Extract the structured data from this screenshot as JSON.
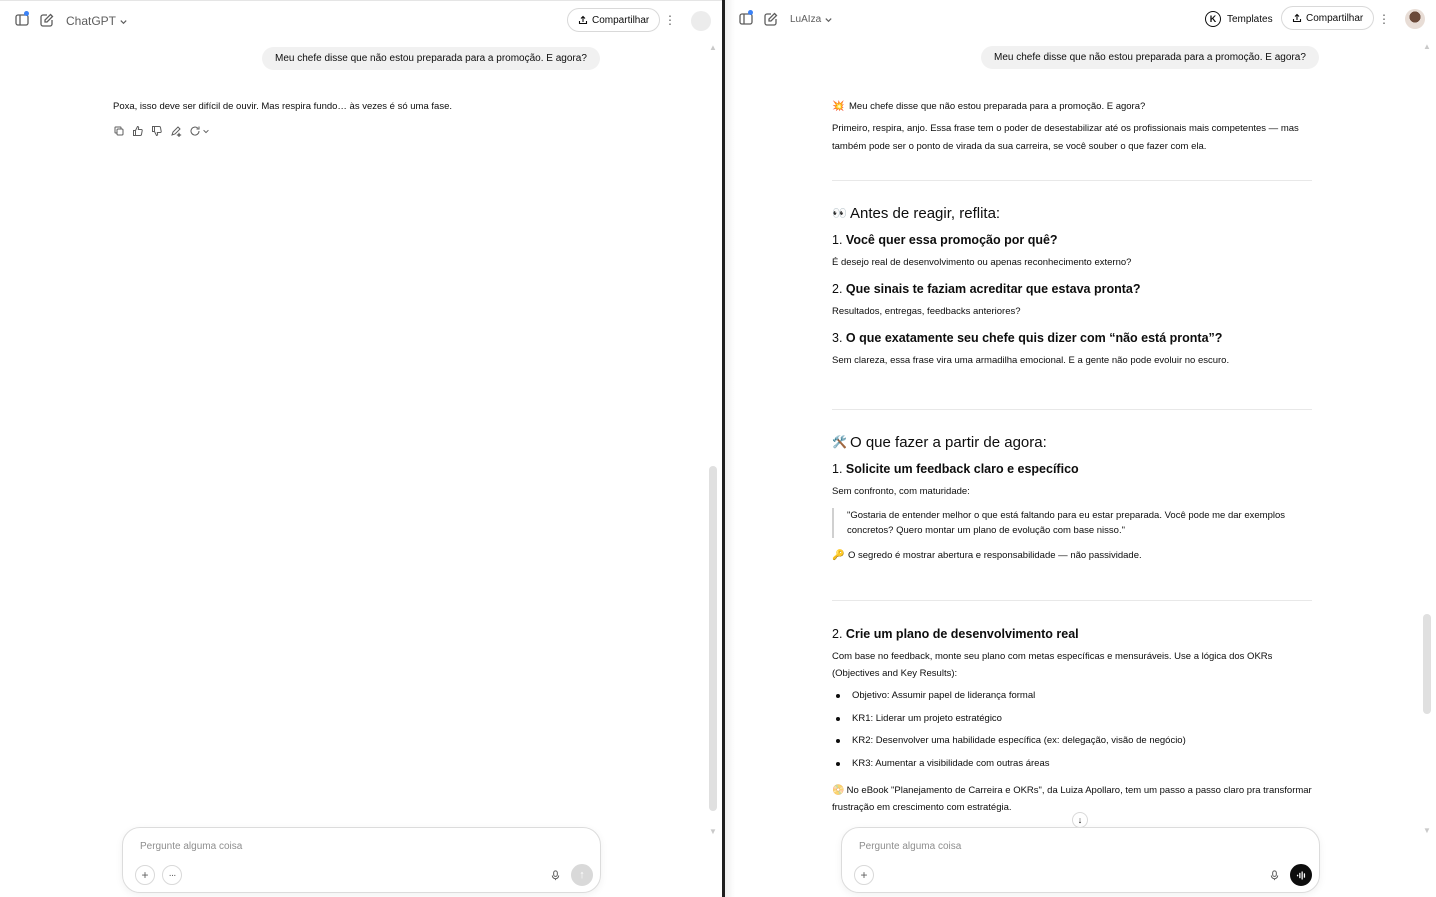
{
  "left": {
    "model_name": "ChatGPT",
    "share_label": "Compartilhar",
    "user_message": "Meu chefe disse que não estou preparada para a promoção. E agora?",
    "assistant_message": "Poxa, isso deve ser difícil de ouvir. Mas respira fundo… às vezes é só uma fase.",
    "composer_placeholder": "Pergunte alguma coisa"
  },
  "right": {
    "model_name": "LuAIza",
    "templates_label": "Templates",
    "share_label": "Compartilhar",
    "user_message": "Meu chefe disse que não estou preparada para a promoção. E agora?",
    "intro_title": "Meu chefe disse que não estou preparada para a promoção. E agora?",
    "intro_text": "Primeiro, respira, anjo. Essa frase tem o poder de desestabilizar até os profissionais mais competentes — mas também pode ser o ponto de virada da sua carreira, se você souber o que fazer com ela.",
    "section1": {
      "emoji": "👀",
      "title": "Antes de reagir, reflita:",
      "items": [
        {
          "num": "1.",
          "title": "Você quer essa promoção por quê?",
          "text": "É desejo real de desenvolvimento ou apenas reconhecimento externo?"
        },
        {
          "num": "2.",
          "title": "Que sinais te faziam acreditar que estava pronta?",
          "text": "Resultados, entregas, feedbacks anteriores?"
        },
        {
          "num": "3.",
          "title": "O que exatamente seu chefe quis dizer com “não está pronta”?",
          "text": "Sem clareza, essa frase vira uma armadilha emocional. E a gente não pode evoluir no escuro."
        }
      ]
    },
    "section2": {
      "emoji": "🛠️",
      "title": "O que fazer a partir de agora:",
      "step1": {
        "num": "1.",
        "title": "Solicite um feedback claro e específico",
        "text": "Sem confronto, com maturidade:",
        "quote": "\"Gostaria de entender melhor o que está faltando para eu estar preparada. Você pode me dar exemplos concretos? Quero montar um plano de evolução com base nisso.\"",
        "tip_emoji": "🔑",
        "tip": "O segredo é mostrar abertura e responsabilidade — não passividade."
      },
      "step2": {
        "num": "2.",
        "title": "Crie um plano de desenvolvimento real",
        "text": "Com base no feedback, monte seu plano com metas específicas e mensuráveis. Use a lógica dos OKRs (Objectives and Key Results):",
        "bullets": [
          {
            "label": "Objetivo:",
            "text": " Assumir papel de liderança formal"
          },
          {
            "label": "KR1:",
            "text": " Liderar um projeto estratégico"
          },
          {
            "label": "KR2:",
            "text": " Desenvolver uma habilidade específica (ex: delegação, visão de negócio)"
          },
          {
            "label": "KR3:",
            "text": " Aumentar a visibilidade com outras áreas"
          }
        ],
        "ebook_emoji": "📀",
        "ebook": "No eBook \"Planejamento de Carreira e OKRs\", da Luiza Apollaro, tem um passo a passo claro pra transformar frustração em crescimento com estratégia."
      }
    },
    "composer_placeholder": "Pergunte alguma coisa"
  }
}
